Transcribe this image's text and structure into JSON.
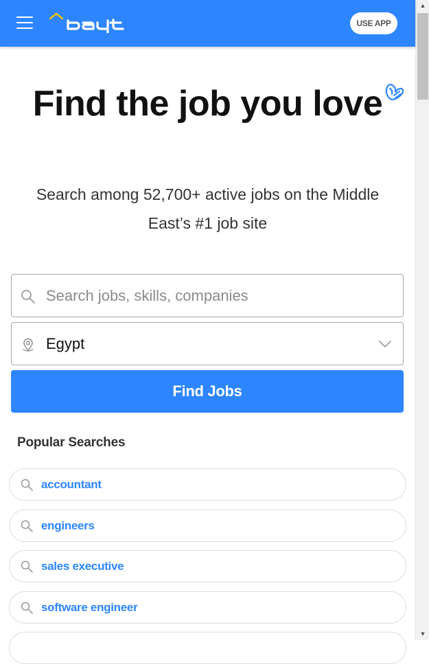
{
  "header": {
    "use_app_label": "USE APP",
    "brand_color": "#2d86ff",
    "logo_text": "bayt"
  },
  "hero": {
    "title": "Find the job you love",
    "subtitle": "Search among 52,700+ active jobs on the Middle East’s #1 job site"
  },
  "search": {
    "placeholder": "Search jobs, skills, companies",
    "value": "",
    "location_value": "Egypt",
    "find_label": "Find Jobs"
  },
  "popular": {
    "title": "Popular Searches",
    "items": [
      {
        "label": "accountant"
      },
      {
        "label": "engineers"
      },
      {
        "label": "sales executive"
      },
      {
        "label": "software engineer"
      }
    ]
  },
  "icons": {
    "menu": "hamburger-menu-icon",
    "search": "search-icon",
    "location": "location-pin-icon",
    "chevron": "chevron-down-icon",
    "heart": "heart-doodle-icon"
  }
}
